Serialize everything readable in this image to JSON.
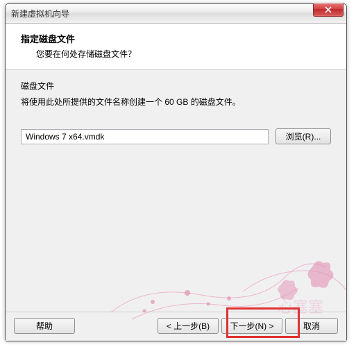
{
  "window": {
    "title": "新建虚拟机向导"
  },
  "header": {
    "title": "指定磁盘文件",
    "subtitle": "您要在何处存储磁盘文件？"
  },
  "content": {
    "section_label": "磁盘文件",
    "section_desc": "将使用此处所提供的文件名称创建一个 60 GB 的磁盘文件。",
    "file_value": "Windows 7 x64.vmdk",
    "browse_label": "浏览(R)..."
  },
  "footer": {
    "help_label": "帮助",
    "back_label": "< 上一步(B)",
    "next_label": "下一步(N) >",
    "cancel_label": "取消"
  }
}
